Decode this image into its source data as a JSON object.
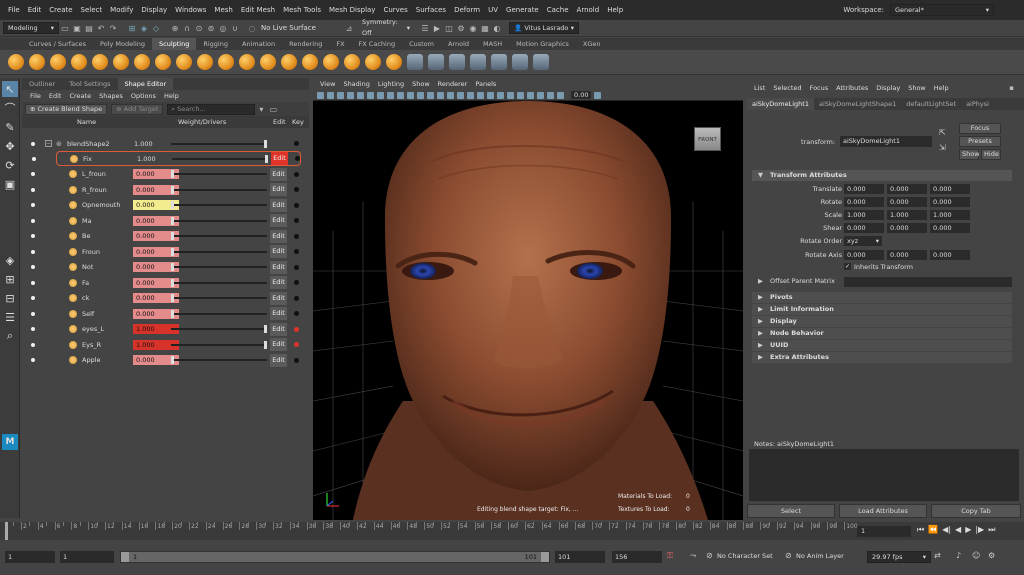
{
  "menubar": {
    "items": [
      "File",
      "Edit",
      "Create",
      "Select",
      "Modify",
      "Display",
      "Windows",
      "Mesh",
      "Edit Mesh",
      "Mesh Tools",
      "Mesh Display",
      "Curves",
      "Surfaces",
      "Deform",
      "UV",
      "Generate",
      "Cache",
      "Arnold",
      "Help"
    ],
    "workspace_label": "Workspace:",
    "workspace_value": "General*"
  },
  "statusline": {
    "mode": "Modeling",
    "live_surface": "No Live Surface",
    "symmetry": "Symmetry: Off",
    "user": "Vitus Lasrado"
  },
  "shelf": {
    "tabs": [
      "Curves / Surfaces",
      "Poly Modeling",
      "Sculpting",
      "Rigging",
      "Animation",
      "Rendering",
      "FX",
      "FX Caching",
      "Custom",
      "Arnold",
      "MASH",
      "Motion Graphics",
      "XGen"
    ],
    "active_tab": "Sculpting"
  },
  "shape_editor": {
    "tabs": [
      "Outliner",
      "Tool Settings",
      "Shape Editor"
    ],
    "menu": [
      "File",
      "Edit",
      "Create",
      "Shapes",
      "Options",
      "Help"
    ],
    "create_blend_shape": "Create Blend Shape",
    "add_target": "Add Target",
    "search_placeholder": "Search...",
    "col_name": "Name",
    "col_weight": "Weight/Drivers",
    "col_edit": "Edit",
    "col_key": "Key",
    "group_name": "blendShape2",
    "group_value": "1.000",
    "edit_label": "Edit",
    "targets": [
      {
        "name": "Fix",
        "value": "1.000",
        "weight": 1.0
      },
      {
        "name": "L_froun",
        "value": "0.000",
        "weight": 0.0
      },
      {
        "name": "R_froun",
        "value": "0.000",
        "weight": 0.0
      },
      {
        "name": "Opnemouth",
        "value": "0.000",
        "weight": 0.0
      },
      {
        "name": "Ma",
        "value": "0.000",
        "weight": 0.0
      },
      {
        "name": "Be",
        "value": "0.000",
        "weight": 0.0
      },
      {
        "name": "Froun",
        "value": "0.000",
        "weight": 0.0
      },
      {
        "name": "Not",
        "value": "0.000",
        "weight": 0.0
      },
      {
        "name": "Fa",
        "value": "0.000",
        "weight": 0.0
      },
      {
        "name": "ck",
        "value": "0.000",
        "weight": 0.0
      },
      {
        "name": "Self",
        "value": "0.000",
        "weight": 0.0
      },
      {
        "name": "eyes_L",
        "value": "1.000",
        "weight": 1.0
      },
      {
        "name": "Eys_R",
        "value": "1.000",
        "weight": 1.0
      },
      {
        "name": "Apple",
        "value": "0.000",
        "weight": 0.0
      }
    ]
  },
  "viewport": {
    "menu": [
      "View",
      "Shading",
      "Lighting",
      "Show",
      "Renderer",
      "Panels"
    ],
    "zoom": "0.00",
    "view_cube": "FRONT",
    "status": "Editing blend shape target: Fix, ...",
    "materials_label": "Materials To Load:",
    "materials_value": "0",
    "textures_label": "Textures To Load:",
    "textures_value": "0"
  },
  "attribute_editor": {
    "menu": [
      "List",
      "Selected",
      "Focus",
      "Attributes",
      "Display",
      "Show",
      "Help"
    ],
    "tabs": [
      "aiSkyDomeLight1",
      "aiSkyDomeLightShape1",
      "defaultLightSet",
      "aiPhysi"
    ],
    "transform_label": "transform:",
    "transform_value": "aiSkyDomeLight1",
    "focus": "Focus",
    "presets": "Presets",
    "show": "Show",
    "hide": "Hide",
    "section_transform": "Transform Attributes",
    "translate_label": "Translate",
    "translate": [
      "0.000",
      "0.000",
      "0.000"
    ],
    "rotate_label": "Rotate",
    "rotate": [
      "0.000",
      "0.000",
      "0.000"
    ],
    "scale_label": "Scale",
    "scale": [
      "1.000",
      "1.000",
      "1.000"
    ],
    "shear_label": "Shear",
    "shear": [
      "0.000",
      "0.000",
      "0.000"
    ],
    "rotate_order_label": "Rotate Order",
    "rotate_order": "xyz",
    "rotate_axis_label": "Rotate Axis",
    "rotate_axis": [
      "0.000",
      "0.000",
      "0.000"
    ],
    "inherits": "Inherits Transform",
    "offset_parent": "Offset Parent Matrix",
    "sections": [
      "Pivots",
      "Limit Information",
      "Display",
      "Node Behavior",
      "UUID",
      "Extra Attributes"
    ],
    "notes_label": "Notes:",
    "notes_value": "aiSkyDomeLight1",
    "btn_select": "Select",
    "btn_load": "Load Attributes",
    "btn_copy": "Copy Tab"
  },
  "timeline": {
    "ticks": [
      "2",
      "4",
      "6",
      "8",
      "10",
      "12",
      "14",
      "16",
      "18",
      "20",
      "22",
      "24",
      "26",
      "28",
      "30",
      "32",
      "34",
      "36",
      "38",
      "40",
      "42",
      "44",
      "46",
      "48",
      "50",
      "52",
      "54",
      "56",
      "58",
      "60",
      "62",
      "64",
      "66",
      "68",
      "70",
      "72",
      "74",
      "76",
      "78",
      "80",
      "82",
      "84",
      "86",
      "88",
      "90",
      "92",
      "94",
      "96",
      "98",
      "100"
    ],
    "current_frame": "1"
  },
  "range": {
    "start": "1",
    "start2": "1",
    "slider_start": "1",
    "slider_end": "101",
    "end": "101",
    "end2": "156",
    "character_set": "No Character Set",
    "anim_layer": "No Anim Layer",
    "fps": "29.97 fps"
  }
}
